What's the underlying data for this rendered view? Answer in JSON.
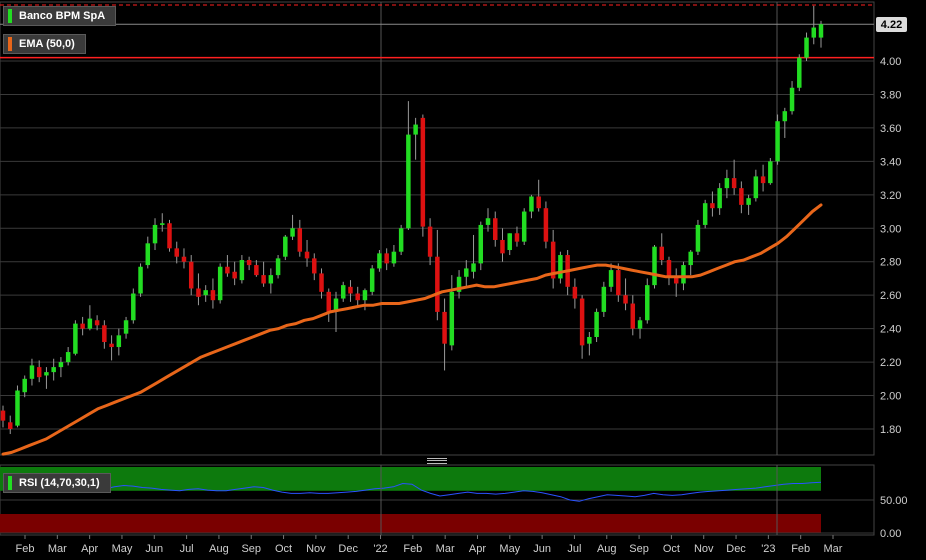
{
  "instrument": "Banco BPM SpA",
  "last_price_label": "4.22",
  "colors": {
    "up": "#22dd22",
    "down": "#dd1111",
    "ema": "#e8661a",
    "rsi_line": "#2a52ff",
    "rsi_overbought": "#0d7a0d",
    "rsi_oversold": "#7a0000",
    "ref_line": "#ff2020"
  },
  "chart_data": [
    {
      "type": "candlestick",
      "title": "Banco BPM SpA",
      "ylim": [
        1.65,
        4.35
      ],
      "yticks": [
        "1.80",
        "2.00",
        "2.20",
        "2.40",
        "2.60",
        "2.80",
        "3.00",
        "3.20",
        "3.40",
        "3.60",
        "3.80",
        "4.00"
      ],
      "ref_lines": [
        4.02,
        4.34
      ],
      "legend_entries": [
        "Banco BPM SpA",
        "EMA (50,0)"
      ],
      "x_labels": [
        "Feb",
        "Mar",
        "Apr",
        "May",
        "Jun",
        "Jul",
        "Aug",
        "Sep",
        "Oct",
        "Nov",
        "Dec",
        "'22",
        "Feb",
        "Mar",
        "Apr",
        "May",
        "Jun",
        "Jul",
        "Aug",
        "Sep",
        "Oct",
        "Nov",
        "Dec",
        "'23",
        "Feb",
        "Mar"
      ],
      "candles": [
        [
          1.91,
          1.94,
          1.81,
          1.85
        ],
        [
          1.84,
          1.88,
          1.77,
          1.8
        ],
        [
          1.82,
          2.06,
          1.81,
          2.03
        ],
        [
          2.02,
          2.12,
          1.99,
          2.1
        ],
        [
          2.1,
          2.22,
          2.06,
          2.18
        ],
        [
          2.17,
          2.21,
          2.08,
          2.11
        ],
        [
          2.12,
          2.17,
          2.04,
          2.14
        ],
        [
          2.14,
          2.22,
          2.09,
          2.17
        ],
        [
          2.17,
          2.23,
          2.11,
          2.2
        ],
        [
          2.2,
          2.29,
          2.18,
          2.26
        ],
        [
          2.25,
          2.45,
          2.24,
          2.43
        ],
        [
          2.43,
          2.47,
          2.36,
          2.4
        ],
        [
          2.4,
          2.54,
          2.39,
          2.46
        ],
        [
          2.45,
          2.48,
          2.39,
          2.42
        ],
        [
          2.42,
          2.45,
          2.28,
          2.32
        ],
        [
          2.31,
          2.36,
          2.21,
          2.29
        ],
        [
          2.29,
          2.4,
          2.24,
          2.36
        ],
        [
          2.37,
          2.47,
          2.34,
          2.45
        ],
        [
          2.45,
          2.64,
          2.43,
          2.61
        ],
        [
          2.61,
          2.79,
          2.59,
          2.77
        ],
        [
          2.78,
          2.95,
          2.76,
          2.91
        ],
        [
          2.91,
          3.06,
          2.87,
          3.02
        ],
        [
          3.02,
          3.09,
          2.98,
          3.03
        ],
        [
          3.03,
          3.05,
          2.86,
          2.88
        ],
        [
          2.88,
          2.92,
          2.79,
          2.83
        ],
        [
          2.83,
          2.88,
          2.76,
          2.8
        ],
        [
          2.8,
          2.84,
          2.6,
          2.64
        ],
        [
          2.64,
          2.73,
          2.54,
          2.59
        ],
        [
          2.6,
          2.66,
          2.56,
          2.63
        ],
        [
          2.63,
          2.7,
          2.52,
          2.57
        ],
        [
          2.57,
          2.79,
          2.55,
          2.77
        ],
        [
          2.77,
          2.84,
          2.71,
          2.73
        ],
        [
          2.74,
          2.8,
          2.66,
          2.7
        ],
        [
          2.69,
          2.84,
          2.67,
          2.81
        ],
        [
          2.81,
          2.83,
          2.75,
          2.78
        ],
        [
          2.78,
          2.81,
          2.71,
          2.72
        ],
        [
          2.72,
          2.8,
          2.65,
          2.67
        ],
        [
          2.67,
          2.76,
          2.61,
          2.72
        ],
        [
          2.72,
          2.84,
          2.7,
          2.82
        ],
        [
          2.83,
          2.96,
          2.81,
          2.95
        ],
        [
          2.95,
          3.08,
          2.93,
          3.0
        ],
        [
          3.0,
          3.05,
          2.83,
          2.86
        ],
        [
          2.86,
          2.93,
          2.77,
          2.82
        ],
        [
          2.82,
          2.85,
          2.69,
          2.73
        ],
        [
          2.73,
          2.76,
          2.58,
          2.62
        ],
        [
          2.62,
          2.64,
          2.44,
          2.5
        ],
        [
          2.5,
          2.62,
          2.38,
          2.58
        ],
        [
          2.58,
          2.68,
          2.56,
          2.66
        ],
        [
          2.65,
          2.69,
          2.56,
          2.61
        ],
        [
          2.61,
          2.65,
          2.53,
          2.57
        ],
        [
          2.57,
          2.64,
          2.51,
          2.63
        ],
        [
          2.62,
          2.78,
          2.6,
          2.76
        ],
        [
          2.76,
          2.87,
          2.74,
          2.85
        ],
        [
          2.85,
          2.88,
          2.75,
          2.79
        ],
        [
          2.79,
          2.9,
          2.77,
          2.86
        ],
        [
          2.86,
          3.02,
          2.84,
          3.0
        ],
        [
          3.0,
          3.76,
          2.99,
          3.56
        ],
        [
          3.56,
          3.66,
          3.41,
          3.62
        ],
        [
          3.66,
          3.68,
          2.95,
          3.01
        ],
        [
          3.01,
          3.06,
          2.78,
          2.83
        ],
        [
          2.83,
          2.99,
          2.45,
          2.5
        ],
        [
          2.5,
          2.58,
          2.15,
          2.31
        ],
        [
          2.3,
          2.72,
          2.27,
          2.62
        ],
        [
          2.62,
          2.75,
          2.58,
          2.71
        ],
        [
          2.71,
          2.81,
          2.65,
          2.76
        ],
        [
          2.74,
          2.96,
          2.7,
          2.79
        ],
        [
          2.79,
          3.04,
          2.75,
          3.02
        ],
        [
          3.02,
          3.12,
          2.98,
          3.06
        ],
        [
          3.06,
          3.1,
          2.89,
          2.93
        ],
        [
          2.93,
          3.0,
          2.8,
          2.85
        ],
        [
          2.87,
          2.97,
          2.84,
          2.97
        ],
        [
          2.97,
          3.01,
          2.89,
          2.92
        ],
        [
          2.92,
          3.12,
          2.9,
          3.1
        ],
        [
          3.1,
          3.2,
          3.06,
          3.19
        ],
        [
          3.19,
          3.29,
          3.1,
          3.12
        ],
        [
          3.12,
          3.16,
          2.88,
          2.92
        ],
        [
          2.92,
          2.99,
          2.64,
          2.7
        ],
        [
          2.7,
          2.86,
          2.67,
          2.84
        ],
        [
          2.84,
          2.87,
          2.6,
          2.65
        ],
        [
          2.65,
          2.7,
          2.52,
          2.58
        ],
        [
          2.58,
          2.6,
          2.22,
          2.3
        ],
        [
          2.31,
          2.38,
          2.24,
          2.35
        ],
        [
          2.35,
          2.52,
          2.32,
          2.5
        ],
        [
          2.5,
          2.68,
          2.47,
          2.65
        ],
        [
          2.65,
          2.79,
          2.62,
          2.75
        ],
        [
          2.75,
          2.79,
          2.56,
          2.6
        ],
        [
          2.6,
          2.7,
          2.51,
          2.55
        ],
        [
          2.55,
          2.6,
          2.36,
          2.4
        ],
        [
          2.4,
          2.47,
          2.34,
          2.45
        ],
        [
          2.45,
          2.7,
          2.43,
          2.66
        ],
        [
          2.66,
          2.9,
          2.64,
          2.89
        ],
        [
          2.89,
          2.97,
          2.78,
          2.81
        ],
        [
          2.81,
          2.83,
          2.66,
          2.71
        ],
        [
          2.71,
          2.76,
          2.59,
          2.67
        ],
        [
          2.67,
          2.8,
          2.63,
          2.78
        ],
        [
          2.78,
          2.87,
          2.72,
          2.86
        ],
        [
          2.86,
          3.05,
          2.84,
          3.02
        ],
        [
          3.02,
          3.17,
          3.0,
          3.15
        ],
        [
          3.15,
          3.22,
          3.07,
          3.12
        ],
        [
          3.12,
          3.27,
          3.08,
          3.24
        ],
        [
          3.24,
          3.35,
          3.18,
          3.3
        ],
        [
          3.3,
          3.41,
          3.2,
          3.24
        ],
        [
          3.24,
          3.28,
          3.09,
          3.14
        ],
        [
          3.14,
          3.2,
          3.08,
          3.18
        ],
        [
          3.18,
          3.35,
          3.16,
          3.31
        ],
        [
          3.31,
          3.38,
          3.22,
          3.27
        ],
        [
          3.27,
          3.42,
          3.26,
          3.4
        ],
        [
          3.4,
          3.68,
          3.38,
          3.64
        ],
        [
          3.64,
          3.72,
          3.54,
          3.7
        ],
        [
          3.7,
          3.88,
          3.68,
          3.84
        ],
        [
          3.84,
          4.04,
          3.82,
          4.02
        ],
        [
          4.02,
          4.17,
          4.0,
          4.14
        ],
        [
          4.14,
          4.33,
          4.1,
          4.2
        ],
        [
          4.14,
          4.24,
          4.08,
          4.22
        ]
      ],
      "ema": {
        "name": "EMA (50,0)",
        "values": [
          1.65,
          1.66,
          1.68,
          1.7,
          1.72,
          1.74,
          1.77,
          1.8,
          1.83,
          1.86,
          1.89,
          1.92,
          1.94,
          1.96,
          1.98,
          2.0,
          2.02,
          2.05,
          2.08,
          2.11,
          2.14,
          2.17,
          2.2,
          2.23,
          2.25,
          2.27,
          2.29,
          2.31,
          2.33,
          2.35,
          2.37,
          2.39,
          2.4,
          2.42,
          2.43,
          2.45,
          2.46,
          2.48,
          2.5,
          2.51,
          2.52,
          2.53,
          2.54,
          2.54,
          2.55,
          2.55,
          2.55,
          2.56,
          2.57,
          2.58,
          2.6,
          2.62,
          2.63,
          2.64,
          2.65,
          2.66,
          2.65,
          2.65,
          2.66,
          2.67,
          2.68,
          2.69,
          2.7,
          2.72,
          2.73,
          2.74,
          2.75,
          2.76,
          2.77,
          2.78,
          2.78,
          2.77,
          2.76,
          2.75,
          2.74,
          2.73,
          2.72,
          2.71,
          2.71,
          2.71,
          2.71,
          2.72,
          2.74,
          2.76,
          2.78,
          2.8,
          2.81,
          2.83,
          2.85,
          2.88,
          2.91,
          2.95,
          3.0,
          3.05,
          3.1,
          3.14
        ]
      }
    },
    {
      "type": "line",
      "title": "RSI (14,70,30,1)",
      "ylim": [
        0,
        100
      ],
      "yticks": [
        "0.00",
        "50.00"
      ],
      "bands": {
        "overbought": 70,
        "oversold": 30
      },
      "series": [
        {
          "name": "RSI (14,70,30,1)",
          "values": [
            68,
            70,
            72,
            71,
            70,
            72,
            73,
            72,
            70,
            68,
            66,
            67,
            70,
            72,
            71,
            69,
            68,
            66,
            65,
            64,
            66,
            67,
            65,
            64,
            64,
            66,
            68,
            70,
            69,
            65,
            62,
            60,
            60,
            61,
            60,
            60,
            61,
            62,
            63,
            65,
            67,
            68,
            70,
            75,
            74,
            65,
            60,
            56,
            58,
            60,
            62,
            60,
            60,
            59,
            60,
            62,
            64,
            63,
            61,
            58,
            55,
            50,
            48,
            52,
            55,
            58,
            57,
            56,
            55,
            57,
            60,
            58,
            57,
            58,
            60,
            62,
            63,
            64,
            65,
            66,
            67,
            68,
            70,
            72,
            74,
            75,
            75,
            76,
            77
          ]
        }
      ]
    }
  ]
}
